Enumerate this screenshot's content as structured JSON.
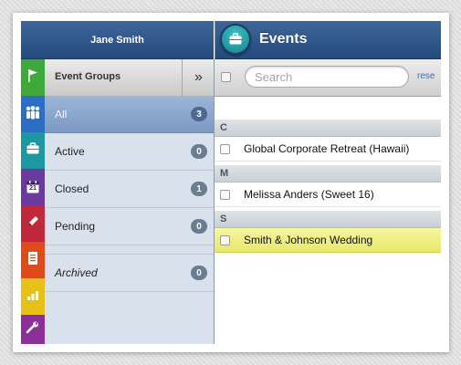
{
  "user": {
    "name": "Jane Smith"
  },
  "header": {
    "title": "Events",
    "icon": "briefcase-icon"
  },
  "rail": {
    "tabs": [
      {
        "icon": "flag-icon",
        "color": "#3fa83a"
      },
      {
        "icon": "people-icon",
        "color": "#2c6fc2"
      },
      {
        "icon": "briefcase-icon",
        "color": "#1e98a0"
      },
      {
        "icon": "calendar-icon",
        "color": "#6a3a9e",
        "label": "21"
      },
      {
        "icon": "pen-icon",
        "color": "#c2283b"
      },
      {
        "icon": "document-icon",
        "color": "#e04b1c"
      },
      {
        "icon": "bar-chart-icon",
        "color": "#e6c11a"
      },
      {
        "icon": "wrench-icon",
        "color": "#8c2f9a"
      }
    ]
  },
  "groups": {
    "title": "Event Groups",
    "collapse_label": "»",
    "items": [
      {
        "label": "All",
        "count": "3",
        "selected": true
      },
      {
        "label": "Active",
        "count": "0"
      },
      {
        "label": "Closed",
        "count": "1"
      },
      {
        "label": "Pending",
        "count": "0"
      },
      {
        "label": "Archived",
        "count": "0",
        "italic": true
      }
    ]
  },
  "search": {
    "placeholder": "Search",
    "value": "",
    "reset_label": "rese"
  },
  "events": {
    "sections": [
      {
        "letter": "C",
        "items": [
          {
            "name": "Global Corporate Retreat (Hawaii)"
          }
        ]
      },
      {
        "letter": "M",
        "items": [
          {
            "name": "Melissa Anders (Sweet 16)"
          }
        ]
      },
      {
        "letter": "S",
        "items": [
          {
            "name": "Smith & Johnson Wedding",
            "highlighted": true
          }
        ]
      }
    ]
  }
}
